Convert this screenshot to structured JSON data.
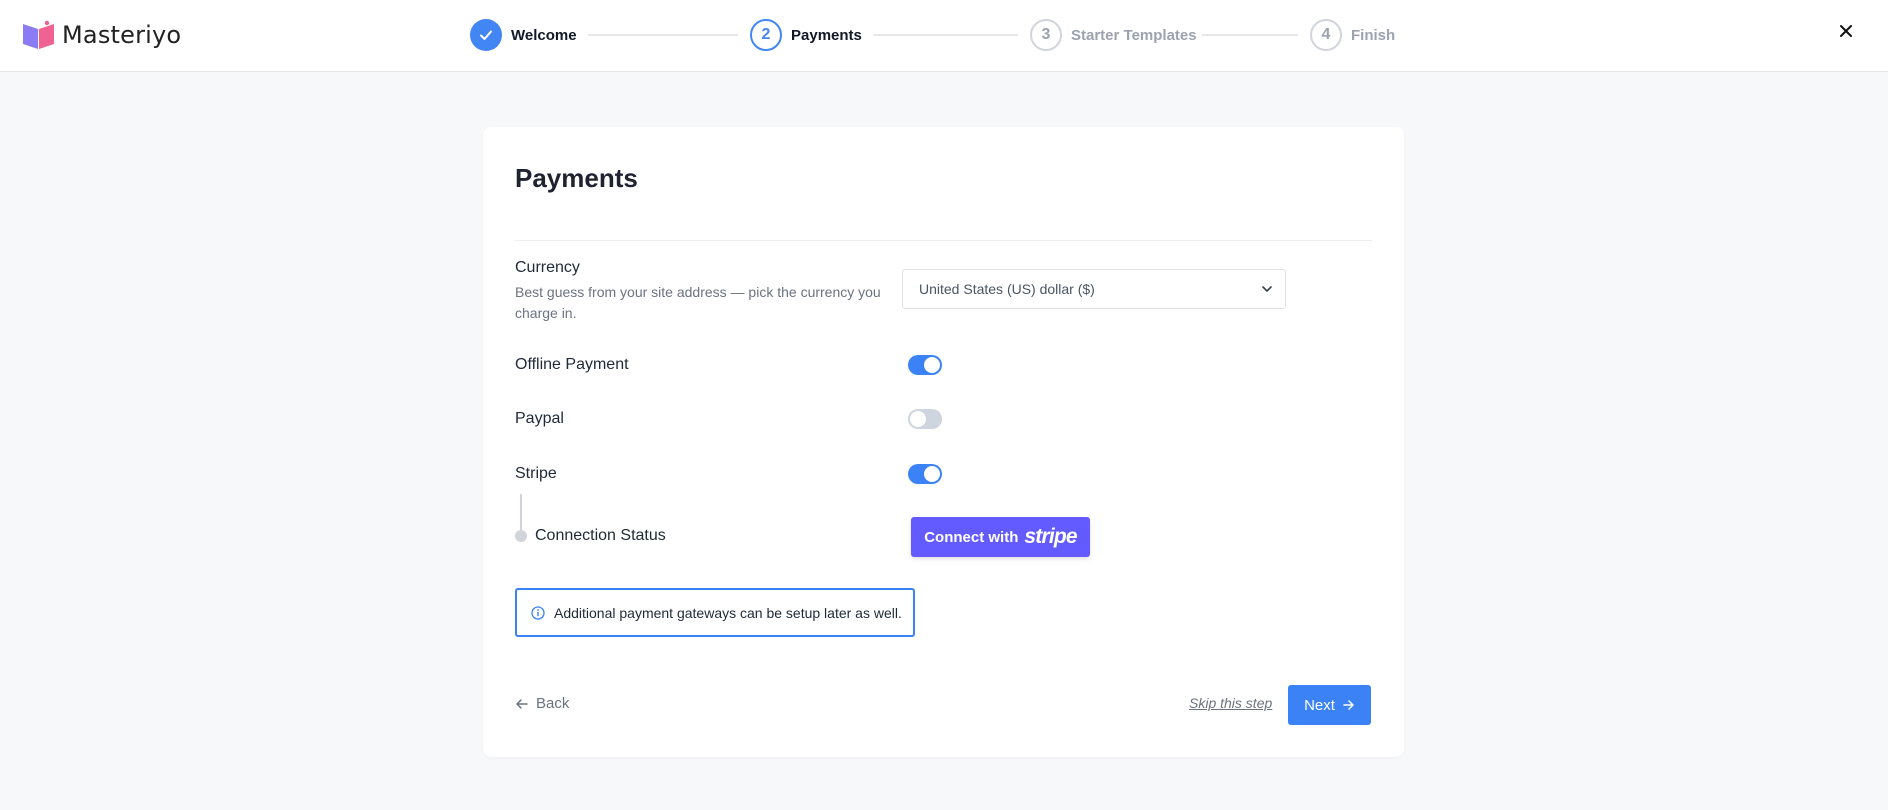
{
  "app": {
    "name": "Masteriyo",
    "colors": {
      "accent": "#3b82f6",
      "stripe": "#635bff",
      "logo_left": "#8b7cf6",
      "logo_right": "#f06292"
    }
  },
  "stepper": {
    "steps": [
      {
        "number": "1",
        "label": "Welcome",
        "state": "completed"
      },
      {
        "number": "2",
        "label": "Payments",
        "state": "active"
      },
      {
        "number": "3",
        "label": "Starter Templates",
        "state": "pending"
      },
      {
        "number": "4",
        "label": "Finish",
        "state": "pending"
      }
    ]
  },
  "icons": {
    "close": "close-icon",
    "chevron": "chevron-down-icon",
    "info": "info-icon",
    "back": "arrow-left-icon",
    "next": "arrow-right-icon",
    "check": "check-icon"
  },
  "card": {
    "title": "Payments",
    "currency": {
      "label": "Currency",
      "help": "Best guess from your site address — pick the currency you charge in.",
      "selected": "United States (US) dollar ($)"
    },
    "offline_payment": {
      "label": "Offline Payment",
      "enabled": true
    },
    "paypal": {
      "label": "Paypal",
      "enabled": false
    },
    "stripe": {
      "label": "Stripe",
      "enabled": true,
      "connection_label": "Connection Status",
      "connect_prefix": "Connect with",
      "connect_brand": "stripe"
    },
    "notice": "Additional payment gateways can be setup later as well.",
    "footer": {
      "back_label": "Back",
      "skip_label": "Skip this step",
      "next_label": "Next"
    }
  }
}
